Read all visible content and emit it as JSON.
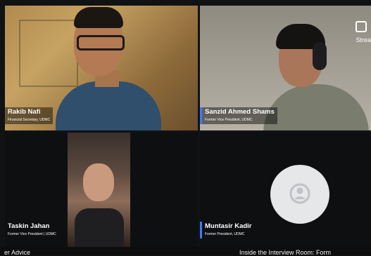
{
  "participants": [
    {
      "name": "Rakib Nafi",
      "role": "Financial Secretary, UDMC"
    },
    {
      "name": "Sanzid Ahmed Shams",
      "role": "Former Vice President, UDMC"
    },
    {
      "name": "Taskin Jahan",
      "role": "Former Vice President | UDMC"
    },
    {
      "name": "Muntasir Kadir",
      "role": "Former President, UDMC"
    }
  ],
  "stream_badge": {
    "label": "Strea",
    "icon": "stream-icon"
  },
  "captions": {
    "left": "er Advice",
    "right": "Inside the Interview Room: Form"
  },
  "colors": {
    "active_speaker_accent": "#3b7bff",
    "background": "#111214"
  }
}
